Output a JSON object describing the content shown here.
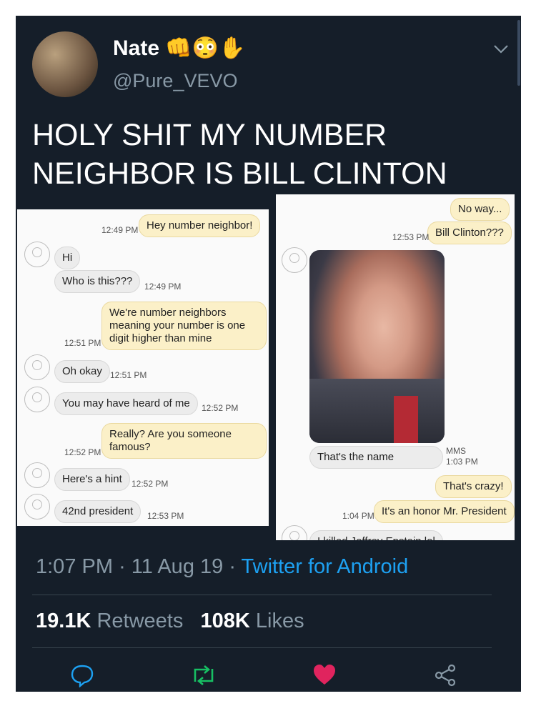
{
  "tweet": {
    "name": "Nate 👊😳✋",
    "handle": "@Pure_VEVO",
    "text": "HOLY SHIT MY NUMBER NEIGHBOR IS BILL CLINTON",
    "time": "1:07 PM",
    "date": "11 Aug 19",
    "source": "Twitter for Android",
    "retweets_count": "19.1K",
    "retweets_label": "Retweets",
    "likes_count": "108K",
    "likes_label": "Likes"
  },
  "shot1": {
    "m1": "Hey number neighbor!",
    "t1": "12:49 PM",
    "m2": "Hi",
    "m3": "Who is this???",
    "t3": "12:49 PM",
    "m4": "We're number neighbors meaning your number is one digit higher than mine",
    "t4": "12:51 PM",
    "m5": "Oh okay",
    "t5": "12:51 PM",
    "m6": "You may have heard of me",
    "t6": "12:52 PM",
    "m7": "Really? Are you someone famous?",
    "t7": "12:52 PM",
    "m8": "Here's a hint",
    "t8": "12:52 PM",
    "m9": "42nd president",
    "t9": "12:53 PM"
  },
  "shot2": {
    "m1": "No way...",
    "m2": "Bill Clinton???",
    "t2": "12:53 PM",
    "m3": "That's the name",
    "mms": "MMS",
    "t3": "1:03 PM",
    "m4": "That's crazy!",
    "m5": "It's an honor Mr. President",
    "t5": "1:04 PM",
    "m6": "I killed Jeffrey Epstein lol"
  },
  "colors": {
    "background": "#151e29",
    "link": "#1da1f2",
    "retweet": "#17bf63",
    "like": "#e0245e",
    "muted": "#8899a6"
  },
  "icons": [
    "reply-icon",
    "retweet-icon",
    "like-icon",
    "share-icon",
    "chevron-down-icon"
  ]
}
